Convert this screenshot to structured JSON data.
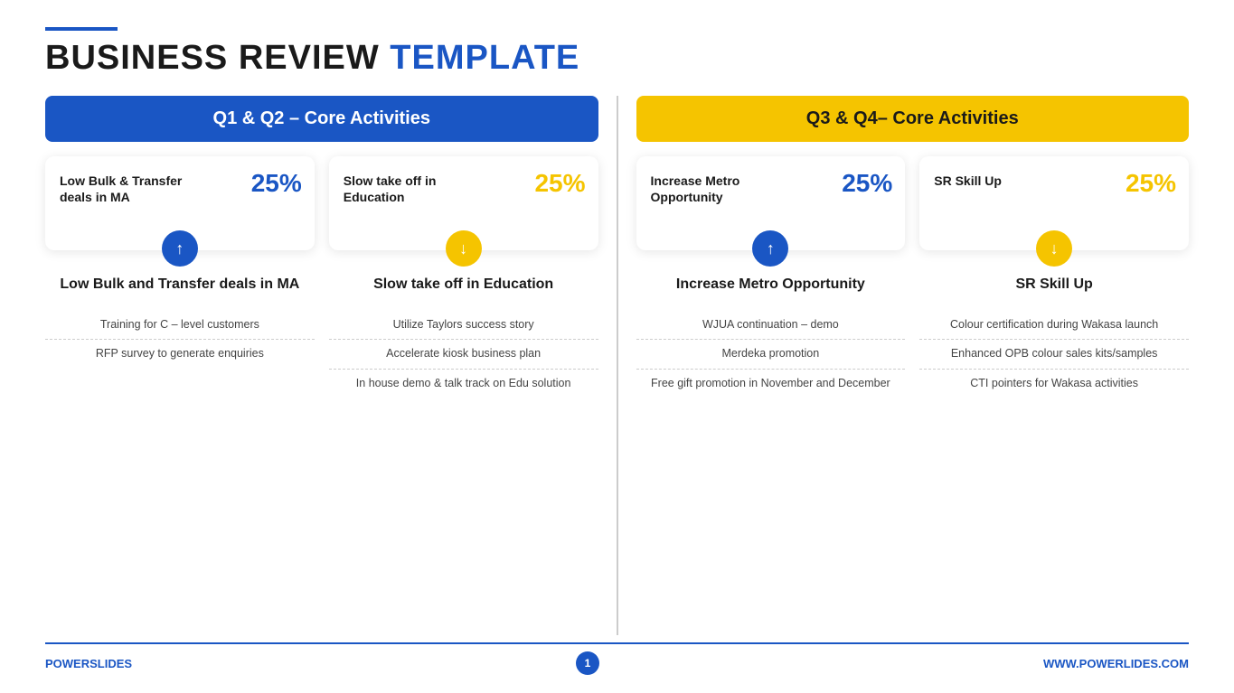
{
  "header": {
    "line_color": "#1a56c4",
    "title_black": "BUSINESS REVIEW",
    "title_blue": "TEMPLATE"
  },
  "left_section": {
    "header": "Q1 & Q2 – Core Activities",
    "header_style": "blue",
    "cards": [
      {
        "text": "Low Bulk & Transfer deals in MA",
        "percent": "25%",
        "percent_style": "blue",
        "icon_style": "blue",
        "icon_direction": "up"
      },
      {
        "text": "Slow take off in Education",
        "percent": "25%",
        "percent_style": "yellow",
        "icon_style": "yellow",
        "icon_direction": "down"
      }
    ],
    "bottom_items": [
      {
        "title": "Low Bulk and Transfer deals in MA",
        "bullets": [
          "Training for C – level customers",
          "RFP survey to generate enquiries"
        ]
      },
      {
        "title": "Slow take off in Education",
        "bullets": [
          "Utilize Taylors success story",
          "Accelerate kiosk business plan",
          "In house demo & talk track on Edu solution"
        ]
      }
    ]
  },
  "right_section": {
    "header": "Q3 & Q4– Core Activities",
    "header_style": "yellow",
    "cards": [
      {
        "text": "Increase Metro Opportunity",
        "percent": "25%",
        "percent_style": "blue",
        "icon_style": "blue",
        "icon_direction": "up"
      },
      {
        "text": "SR Skill Up",
        "percent": "25%",
        "percent_style": "yellow",
        "icon_style": "yellow",
        "icon_direction": "down"
      }
    ],
    "bottom_items": [
      {
        "title": "Increase Metro Opportunity",
        "bullets": [
          "WJUA continuation – demo",
          "Merdeka promotion",
          "Free gift promotion in November and December"
        ]
      },
      {
        "title": "SR Skill Up",
        "bullets": [
          "Colour certification during Wakasa launch",
          "Enhanced OPB colour sales kits/samples",
          "CTI pointers for Wakasa activities"
        ]
      }
    ]
  },
  "footer": {
    "left_label": "POWER",
    "left_label_blue": "SLIDES",
    "page_number": "1",
    "right_label": "WWW.POWERLIDES.COM"
  }
}
